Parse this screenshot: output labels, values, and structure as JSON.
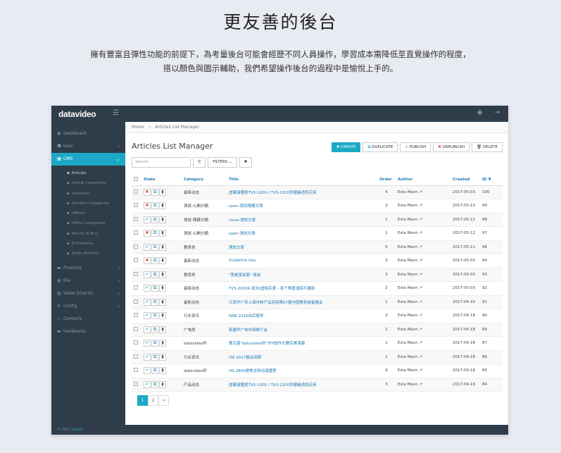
{
  "hero": {
    "title": "更友善的後台",
    "line1": "擁有豐富且彈性功能的前提下，為考量後台可能會經歷不同人員操作，學習成本需降低至直覺操作的程度，",
    "line2": "搭以顏色與圖示輔助，我們希望操作後台的過程中是愉悅上手的。"
  },
  "app": {
    "logo": "datavideo",
    "footer_prefix": "© 2017",
    "footer_link": "Lorem"
  },
  "sidebar": {
    "items": [
      {
        "label": "Dashboard",
        "icon": "dashboard-icon",
        "glyph": "◉"
      },
      {
        "label": "User",
        "icon": "user-icon",
        "glyph": "☻",
        "arrow": "‹"
      },
      {
        "label": "CMS",
        "icon": "grid-icon",
        "glyph": "▦",
        "arrow": "⌄",
        "active": true
      },
      {
        "label": "Products",
        "icon": "products-icon",
        "glyph": "▬",
        "arrow": "‹"
      },
      {
        "label": "File",
        "icon": "file-icon",
        "glyph": "▤",
        "arrow": "‹"
      },
      {
        "label": "Video Director",
        "icon": "video-icon",
        "glyph": "▥",
        "arrow": "‹"
      },
      {
        "label": "Config",
        "icon": "config-icon",
        "glyph": "✲",
        "arrow": "‹"
      },
      {
        "label": "Contacts",
        "icon": "contacts-icon",
        "glyph": "▭"
      },
      {
        "label": "Hardwares",
        "icon": "hardware-icon",
        "glyph": "▬"
      }
    ],
    "cms_sub": [
      "Articles",
      "Article Categories",
      "Solutions",
      "Solution Categories",
      "Offices",
      "Office Categories",
      "Where To Buy",
      "Exhibitions",
      "Static Articles"
    ]
  },
  "breadcrumb": {
    "home": "Home",
    "sep": "»",
    "current": "Articles List Manager"
  },
  "page": {
    "title": "Articles List Manager"
  },
  "actions": {
    "create": "CREATE",
    "duplicate": "DUPLICATE",
    "publish": "PUBLISH",
    "unpublish": "UNPUBLISH",
    "delete": "DELETE"
  },
  "toolbar": {
    "search_placeholder": "Search",
    "filters": "FILTERS",
    "search_glyph": "⚲",
    "clear_glyph": "✖"
  },
  "table": {
    "headers": [
      "State",
      "Category",
      "Title",
      "Order",
      "Author",
      "Created",
      "ID"
    ],
    "rows": [
      {
        "published": false,
        "category": "最新动态",
        "title": "虛擬演播室TVS-1000 / TVS-1200供捷键述即应用",
        "order": "4",
        "author": "Esta Mann",
        "created": "2017-05-03",
        "id": "100"
      },
      {
        "published": false,
        "category": "測試-公開分類",
        "title": "open-測試隱藏文章",
        "order": "2",
        "author": "Esta Mann",
        "created": "2017-05-12",
        "id": "99"
      },
      {
        "published": true,
        "category": "測試-隱藏分類",
        "title": "close-測試文章",
        "order": "1",
        "author": "Esta Mann",
        "created": "2017-05-12",
        "id": "98"
      },
      {
        "published": false,
        "category": "測試-公開分類",
        "title": "open-測試文章",
        "order": "1",
        "author": "Esta Mann",
        "created": "2017-05-12",
        "id": "97"
      },
      {
        "published": true,
        "category": "教育类",
        "title": "測試文章",
        "order": "5",
        "author": "Esta Mann",
        "created": "2017-05-11",
        "id": "96"
      },
      {
        "published": false,
        "category": "最新动态",
        "title": "Guideline Use",
        "order": "3",
        "author": "Esta Mann",
        "created": "2017-05-03",
        "id": "94"
      },
      {
        "published": true,
        "category": "教育类",
        "title": "\"我是演说家\" 海选",
        "order": "3",
        "author": "Esta Mann",
        "created": "2017-05-03",
        "id": "93"
      },
      {
        "published": true,
        "category": "最新动态",
        "title": "TVS-2000A 真3D虛拟实景 - 各个角度追踪不漏拍",
        "order": "2",
        "author": "Esta Mann",
        "created": "2017-05-03",
        "id": "92"
      },
      {
        "published": true,
        "category": "最新动态",
        "title": "江西华广传上海洋林产品亮相第67届中国教育装备展会",
        "order": "1",
        "author": "Esta Mann",
        "created": "2017-04-20",
        "id": "91"
      },
      {
        "published": true,
        "category": "行业资讯",
        "title": "NAB 2016台后报导",
        "order": "2",
        "author": "Esta Mann",
        "created": "2017-04-18",
        "id": "90"
      },
      {
        "published": true,
        "category": "广电类",
        "title": "新疆华广电市场推介会",
        "order": "1",
        "author": "Esta Mann",
        "created": "2017-04-18",
        "id": "89"
      },
      {
        "published": true,
        "category": "datavideo杯",
        "title": "第五届\"datavideo杯\"TFP創作大赛完美落幕",
        "order": "1",
        "author": "Esta Mann",
        "created": "2017-04-18",
        "id": "87"
      },
      {
        "published": true,
        "category": "行业资讯",
        "title": "ISE 2017展会回顾",
        "order": "1",
        "author": "Esta Mann",
        "created": "2017-04-18",
        "id": "86"
      },
      {
        "published": true,
        "category": "datavideo杯",
        "title": "HS-2800便携式移动演播室",
        "order": "4",
        "author": "Esta Mann",
        "created": "2017-04-18",
        "id": "85"
      },
      {
        "published": true,
        "category": "产品动态",
        "title": "虛擬演播室TVS-1000 / TVS-1200供捷键述即应用",
        "order": "3",
        "author": "Esta Mann",
        "created": "2017-04-18",
        "id": "84"
      }
    ]
  },
  "pagination": {
    "pages": [
      "1",
      "2"
    ],
    "next": "»"
  },
  "colors": {
    "accent": "#1ba9c7",
    "sidebar": "#2f3d4a",
    "publish": "#2bbd7e",
    "unpublish": "#e04545"
  }
}
